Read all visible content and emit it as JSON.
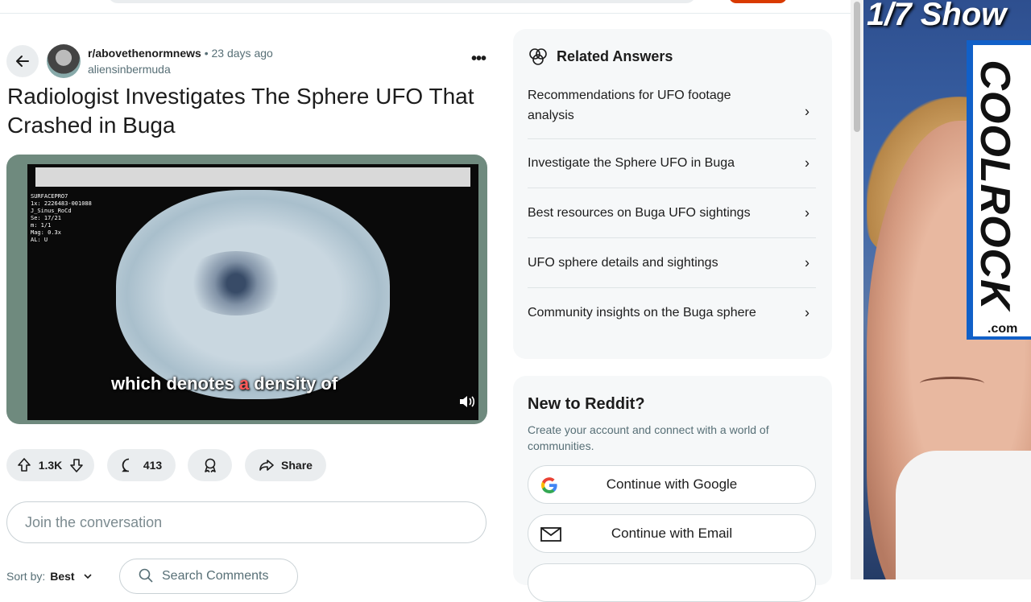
{
  "post": {
    "subreddit": "r/abovethenormnews",
    "separator": "•",
    "age": "23 days ago",
    "author": "aliensinbermuda",
    "title": "Radiologist Investigates The Sphere UFO That Crashed in Buga",
    "video": {
      "caption_before": "which denotes ",
      "caption_highlight": "a",
      "caption_after": " density of",
      "screen_text": [
        "SURFACEPRO7",
        "1x: 2226483-001088",
        "J_Sinus_RoCd",
        "Se: 17/21",
        "m: 1/1",
        "",
        "Mag: 0.3x",
        "AL: U"
      ]
    },
    "votes": "1.3K",
    "comments": "413",
    "share_label": "Share"
  },
  "comment_box": {
    "placeholder": "Join the conversation"
  },
  "sort": {
    "label": "Sort by:",
    "value": "Best"
  },
  "search_comments": {
    "placeholder": "Search Comments"
  },
  "related": {
    "title": "Related Answers",
    "items": [
      "Recommendations for UFO footage analysis",
      "Investigate the Sphere UFO in Buga",
      "Best resources on Buga UFO sightings",
      "UFO sphere details and sightings",
      "Community insights on the Buga sphere"
    ]
  },
  "new_to_reddit": {
    "title": "New to Reddit?",
    "subtitle": "Create your account and connect with a world of communities.",
    "google": "Continue with Google",
    "email": "Continue with Email"
  },
  "stream_overlay": {
    "show_text": "1/7 Show",
    "logo_text": "COOLROCK",
    "logo_domain": ".com"
  },
  "colors": {
    "brand_orange": "#d93a00",
    "logo_blue": "#1160c8",
    "muted": "#576f76"
  },
  "icons": [
    "back-arrow-icon",
    "more-icon",
    "upvote-icon",
    "downvote-icon",
    "comment-icon",
    "award-icon",
    "share-icon",
    "related-answers-icon",
    "chevron-right-icon",
    "google-icon",
    "email-icon",
    "mute-icon",
    "search-icon",
    "chevron-down-icon"
  ]
}
